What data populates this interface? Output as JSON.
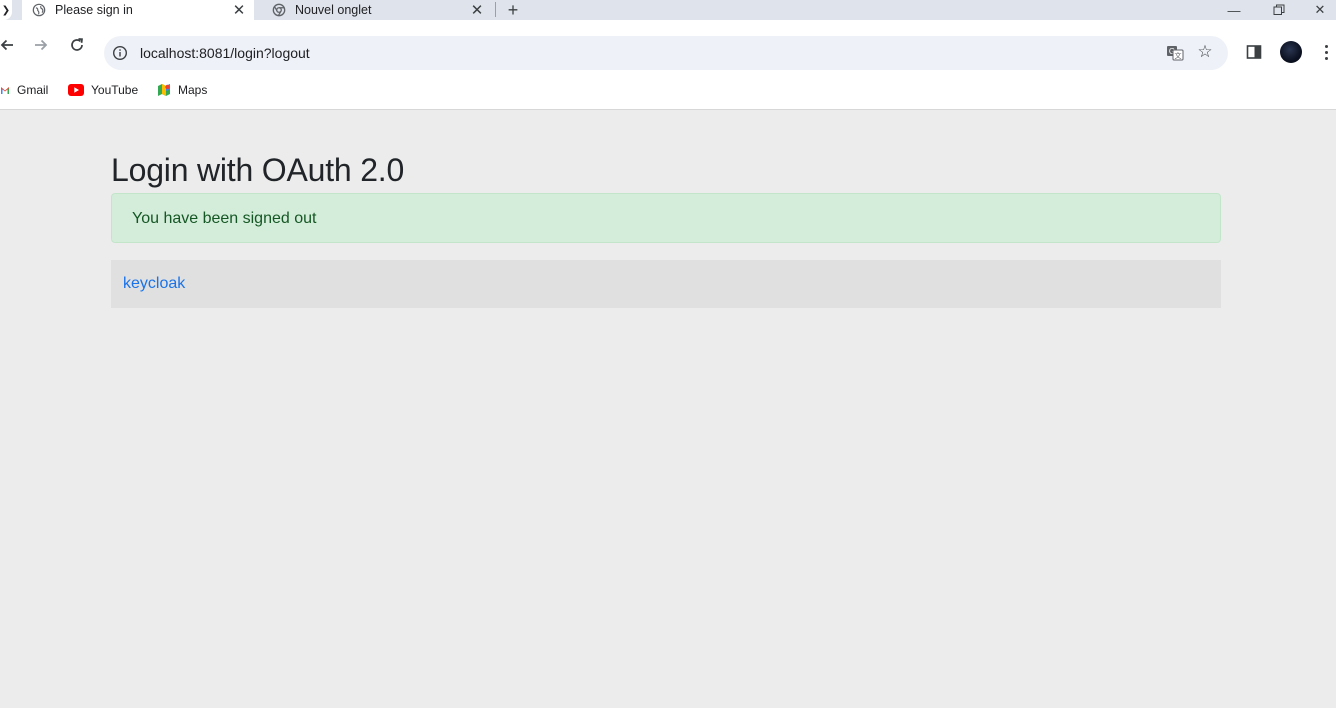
{
  "browser": {
    "tabs": [
      {
        "title": "Please sign in",
        "active": true
      },
      {
        "title": "Nouvel onglet",
        "active": false
      }
    ],
    "url": "localhost:8081/login?logout",
    "bookmarks": [
      {
        "label": "Gmail",
        "icon": "gmail-icon"
      },
      {
        "label": "YouTube",
        "icon": "youtube-icon"
      },
      {
        "label": "Maps",
        "icon": "maps-icon"
      }
    ],
    "colors": {
      "tabstrip": "#dfe3eb",
      "omnibox": "#eef1f7",
      "link": "#1a73e8"
    }
  },
  "page": {
    "heading": "Login with OAuth 2.0",
    "alert_message": "You have been signed out",
    "providers": [
      {
        "label": "keycloak"
      }
    ],
    "colors": {
      "background": "#ececec",
      "alert_bg": "#d4edda",
      "alert_text": "#155724"
    }
  }
}
